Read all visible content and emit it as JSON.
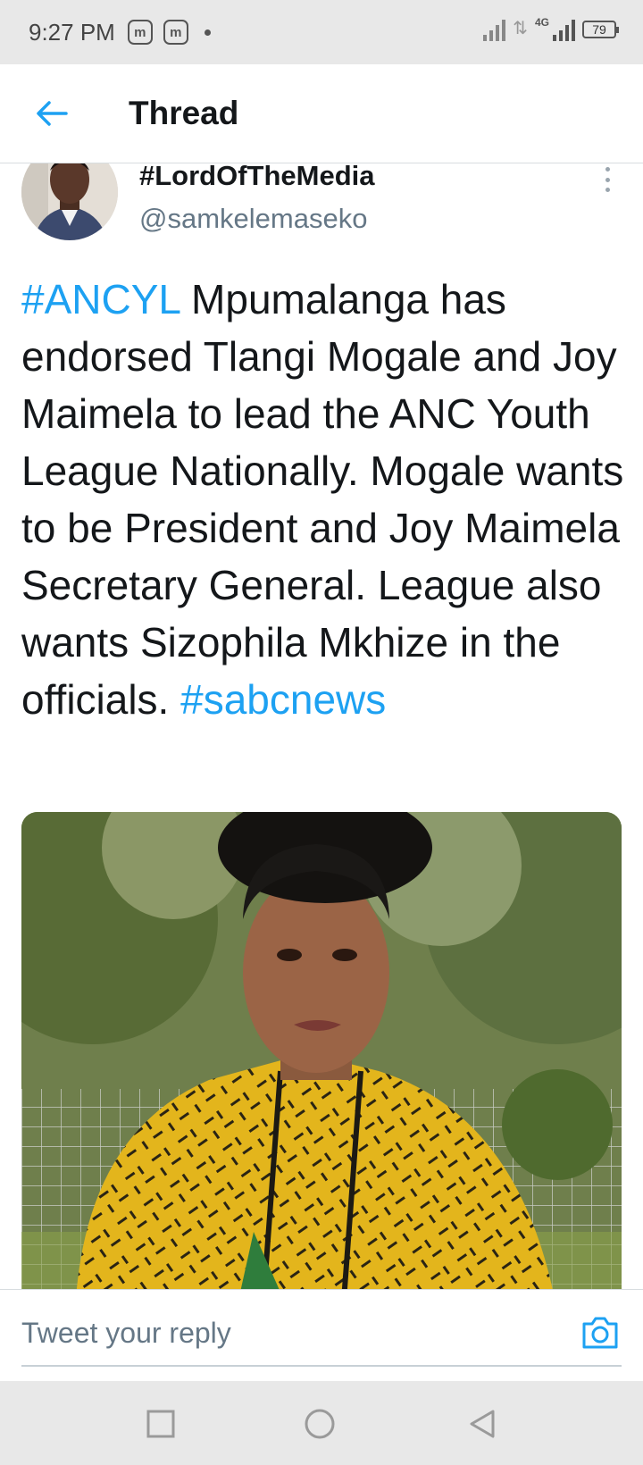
{
  "status_bar": {
    "time": "9:27 PM",
    "app_icon_label": "m",
    "network": "4G",
    "battery": "79"
  },
  "header": {
    "title": "Thread",
    "back_icon": "arrow-left-icon"
  },
  "tweet": {
    "display_name": "#LordOfTheMedia",
    "handle": "@samkelemaseko",
    "text_parts": {
      "hashtag1": "#ANCYL",
      "body": " Mpumalanga has endorsed Tlangi Mogale and Joy Maimela to lead the ANC Youth League Nationally. Mogale wants to be President and Joy Maimela Secretary General. League also wants Sizophila Mkhize in the officials. ",
      "hashtag2": "#sabcnews"
    },
    "more_icon": "more-vertical-icon"
  },
  "reply": {
    "placeholder": "Tweet your reply",
    "camera_icon": "camera-icon"
  },
  "colors": {
    "accent": "#1da1f2",
    "text": "#14171a",
    "muted": "#657786"
  }
}
